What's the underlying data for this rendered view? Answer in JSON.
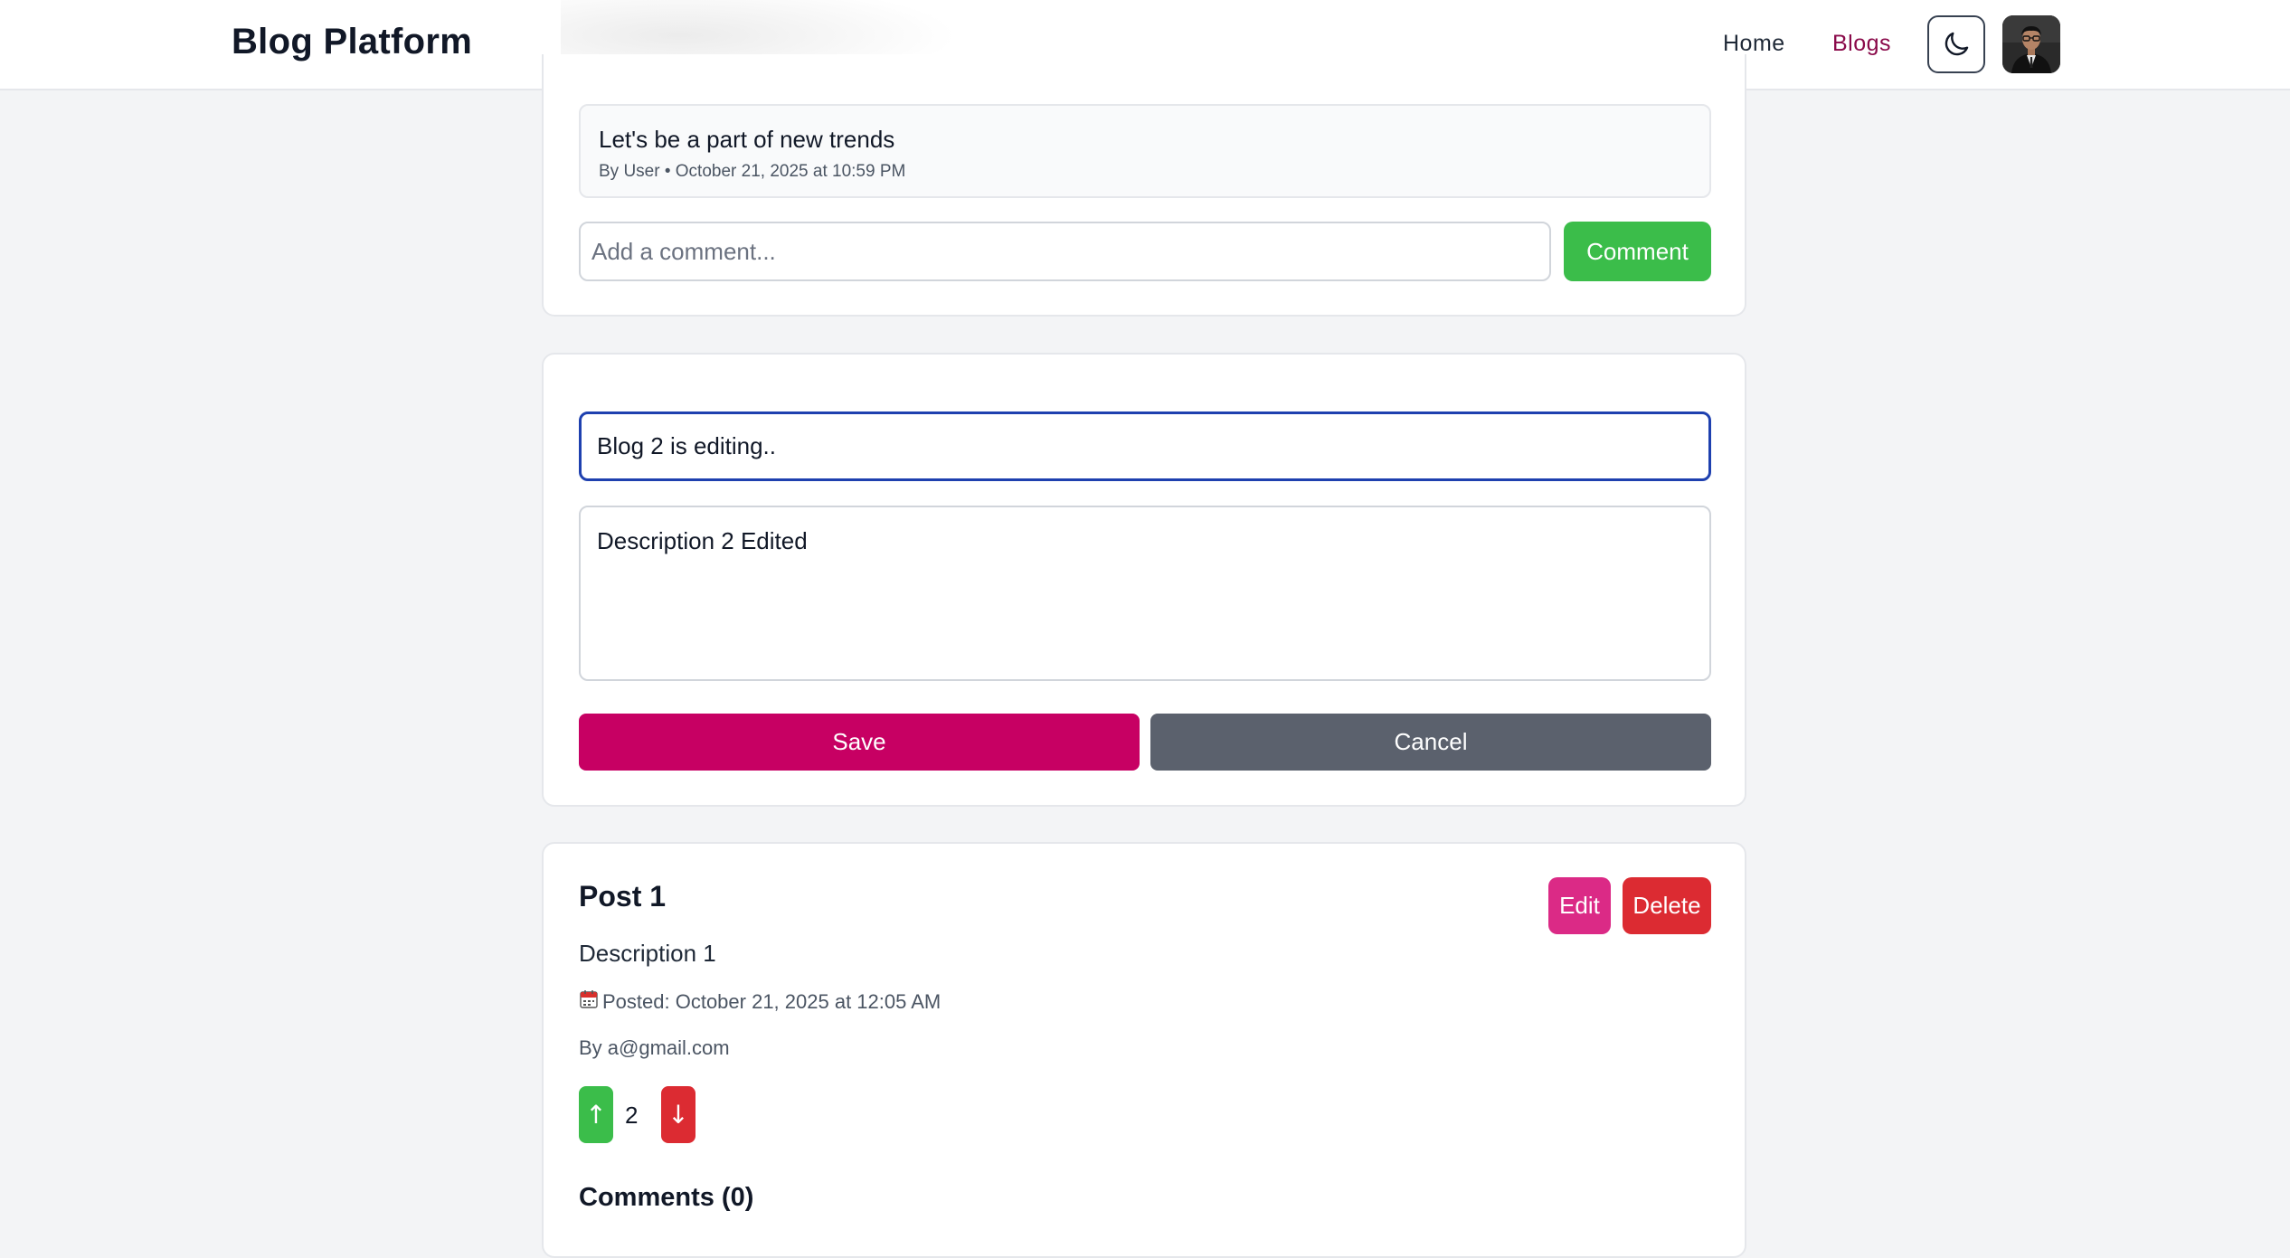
{
  "header": {
    "brand": "Blog Platform",
    "nav": {
      "home": "Home",
      "blogs": "Blogs"
    },
    "icons": {
      "theme": "moon-icon",
      "avatar": "user-avatar"
    }
  },
  "post_above": {
    "comments": [
      {
        "text": "Let's be a part of new trends",
        "meta": "By User • October 21, 2025 at 10:59 PM"
      }
    ],
    "comment_input": {
      "placeholder": "Add a comment...",
      "value": ""
    },
    "comment_button": "Comment"
  },
  "edit_form": {
    "title_value": "Blog 2 is editing..",
    "description_value": "Description 2 Edited",
    "save_label": "Save",
    "cancel_label": "Cancel"
  },
  "post": {
    "title": "Post 1",
    "description": "Description 1",
    "posted": "Posted: October 21, 2025 at 12:05 AM",
    "author": "By a@gmail.com",
    "edit_label": "Edit",
    "delete_label": "Delete",
    "upvote_symbol": "↑",
    "downvote_symbol": "↓",
    "vote_count": "2",
    "comments_heading": "Comments (0)"
  },
  "colors": {
    "accent": "#c70063",
    "nav_active": "#8a0a4a",
    "success": "#3bbd4a",
    "danger": "#dc2b32",
    "edit": "#db2a86",
    "neutral": "#5b616d",
    "focus_border": "#1e40af"
  }
}
